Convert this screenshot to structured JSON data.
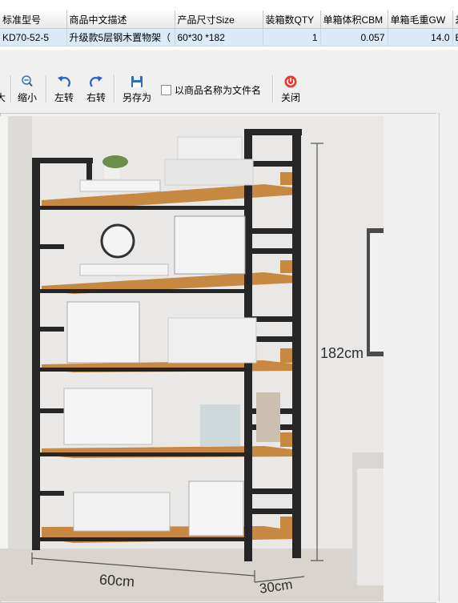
{
  "grid": {
    "headers": [
      "标准型号",
      "商品中文描述",
      "产品尺寸Size",
      "装箱数QTY",
      "单箱体积CBM",
      "单箱毛重GW",
      "差"
    ],
    "row": [
      "KD70-52-5",
      "升级款5层钢木置物架（",
      "60*30 *182",
      "1",
      "0.057",
      "14.0",
      "E"
    ]
  },
  "toolbar": {
    "partial_label": "大",
    "zoom_out_label": "缩小",
    "rotate_left_label": "左转",
    "rotate_right_label": "右转",
    "save_as_label": "另存为",
    "use_name_label": "以商品名称为文件名",
    "close_label": "关闭"
  },
  "image": {
    "height_dim": "182cm",
    "width_dim": "60cm",
    "depth_dim": "30cm"
  },
  "colors": {
    "selected_row": "#dce9f6",
    "wood": "#c98a44",
    "frame": "#2a2a2a"
  }
}
